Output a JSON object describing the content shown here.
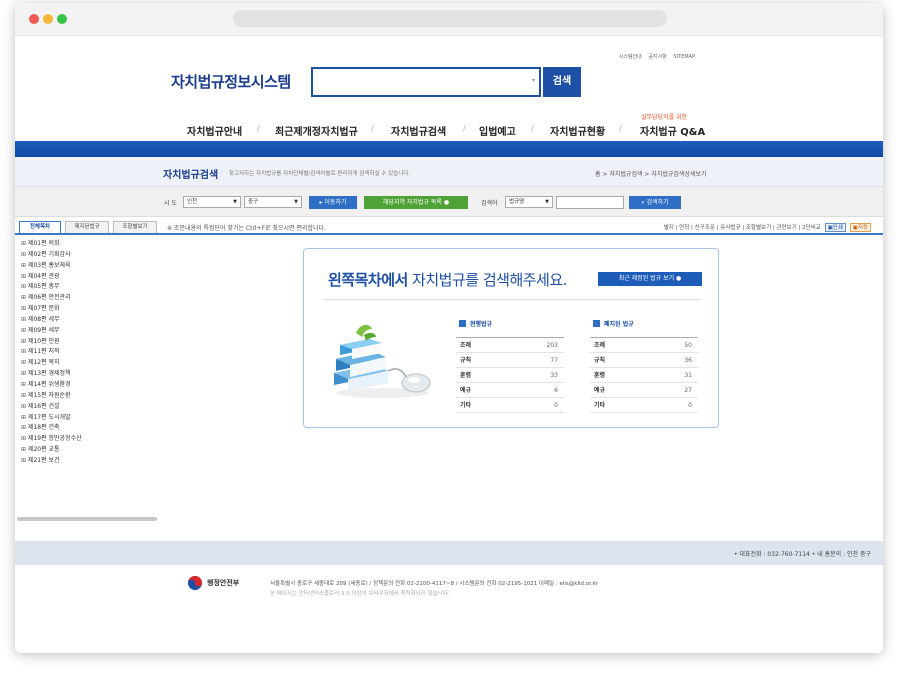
{
  "header": {
    "top_links": [
      "시스템안내",
      "공지사항",
      "SITEMAP"
    ],
    "logo": "자치법규정보시스템",
    "search_button": "검색"
  },
  "gnb": {
    "items": [
      "자치법규안내",
      "최근제개정자치법규",
      "자치법규검색",
      "입법예고",
      "자치법규현황",
      "자치법규 Q&A"
    ],
    "qa_subtitle": "실무담당자를 위한"
  },
  "subheader": {
    "title": "자치법규검색",
    "description": "찾고자하는 자치법규를 자치단체별/검색어별로 편리하게 검색하실 수 있습니다.",
    "breadcrumb": "홈 > 자치법규검색 > 자치법규검색상세보기"
  },
  "filters": {
    "sido_label": "시 도",
    "sido_value": "인천",
    "sigungu_value": "중구",
    "move_button": "이동하기",
    "region_list_button": "해당지역 자치법규 목록",
    "keyword_label": "검색어",
    "keyword_type": "법규명",
    "search_button": "검색하기"
  },
  "tabs": [
    "전체목차",
    "제지된법규",
    "조항별보기"
  ],
  "notice": "※ 조문내용의 특정단어 찾기는 Ctrl+F로 찾으시면 편리합니다.",
  "tools": [
    "별지",
    "연혁",
    "신구조문",
    "유사법규",
    "조항별보기",
    "관련보기",
    "2단비교"
  ],
  "tool_buttons": {
    "print": "인쇄",
    "save": "저장"
  },
  "tree": [
    "제01편 의회",
    "제02편 기획감사",
    "제03편 홍보체육",
    "제04편 관광",
    "제05편 총무",
    "제06편 안전관리",
    "제07편 문화",
    "제08편 세무",
    "제09편 세무",
    "제10편 민원",
    "제11편 지적",
    "제12편 복지",
    "제13편 경제정책",
    "제14편 위생환경",
    "제15편 자원순환",
    "제16편 건설",
    "제17편 도시개발",
    "제18편 건축",
    "제19편 항만공항수산",
    "제20편 교통",
    "제21편 보건"
  ],
  "panel": {
    "headline_bold": "왼쪽목차에서",
    "headline_rest": " 자치법규를 검색해주세요.",
    "recent_button": "최근 제정된 법규 보기",
    "current": {
      "title": "현행법규",
      "rows": [
        {
          "k": "조례",
          "v": "203"
        },
        {
          "k": "규칙",
          "v": "77"
        },
        {
          "k": "훈령",
          "v": "33"
        },
        {
          "k": "예규",
          "v": "6"
        },
        {
          "k": "기타",
          "v": "0"
        }
      ]
    },
    "repealed": {
      "title": "폐지된 법규",
      "rows": [
        {
          "k": "조례",
          "v": "50"
        },
        {
          "k": "규칙",
          "v": "36"
        },
        {
          "k": "훈령",
          "v": "31"
        },
        {
          "k": "예규",
          "v": "27"
        },
        {
          "k": "기타",
          "v": "0"
        }
      ]
    }
  },
  "footer": {
    "contact": "• 대표전화 : 032-760-7114  • 내 홈문의 : 인천 중구",
    "org_name": "행정안전부",
    "address": "서울특별시 종로구 세종대로 209 (세종로) / 정책문의 전화 02-2100-4117~8 / 시스템문의 전화 02-2195-1021 이메일 : elis@klid.or.kr",
    "copyright": "본 페이지는 인터넷익스플로러 9.0 이상의 브라우저에서 최적화되어 있습니다."
  }
}
